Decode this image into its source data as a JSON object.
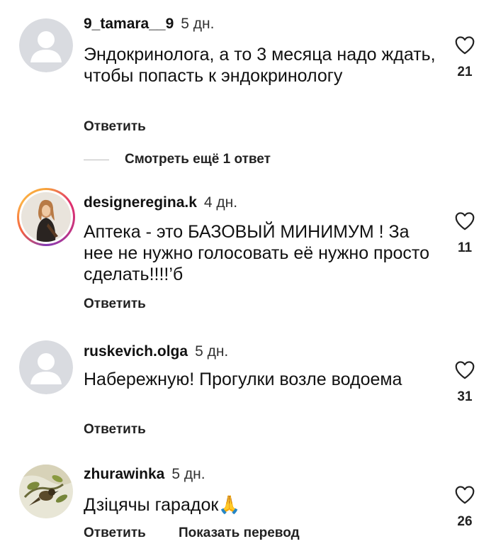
{
  "comments": [
    {
      "username": "9_tamara__9",
      "time": "5 дн.",
      "text": "Эндокринолога, а то 3 месяца надо ждать, чтобы попасть к эндокринологу",
      "reply_label": "Ответить",
      "likes": "21",
      "avatar": "default-avatar"
    },
    {
      "username": "designeregina.k",
      "time": "4 дн.",
      "text": "Аптека - это БАЗОВЫЙ МИНИМУМ ! За нее не нужно голосовать её нужно просто сделать!!!!’б",
      "reply_label": "Ответить",
      "likes": "11",
      "avatar": "photo-with-story-ring"
    },
    {
      "username": "ruskevich.olga",
      "time": "5 дн.",
      "text": "Набережную! Прогулки возле водоема",
      "reply_label": "Ответить",
      "likes": "31",
      "avatar": "default-avatar"
    },
    {
      "username": "zhurawinka",
      "time": "5 дн.",
      "text": "Дзіцячы гарадок🙏",
      "reply_label": "Ответить",
      "translate_label": "Показать перевод",
      "likes": "26",
      "avatar": "bird-photo"
    }
  ],
  "view_more_replies": "Смотреть ещё 1 ответ",
  "icons": {
    "like": "heart-outline-icon",
    "default_avatar": "person-silhouette-icon"
  },
  "colors": {
    "text": "#111111",
    "default_avatar_bg": "#d9dbe0",
    "default_avatar_fg": "#ffffff",
    "heart_stroke": "#222222"
  }
}
